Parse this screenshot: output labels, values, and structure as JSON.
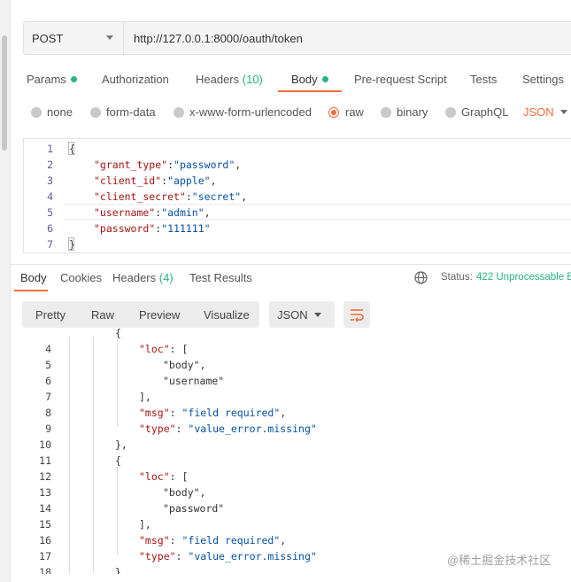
{
  "request": {
    "method": "POST",
    "url": "http://127.0.0.1:8000/oauth/token"
  },
  "request_tabs": {
    "params": "Params",
    "authorization": "Authorization",
    "headers": "Headers",
    "headers_count": "(10)",
    "body": "Body",
    "pre_request": "Pre-request Script",
    "tests": "Tests",
    "settings": "Settings"
  },
  "body_types": {
    "none": "none",
    "form_data": "form-data",
    "urlencoded": "x-www-form-urlencoded",
    "raw": "raw",
    "binary": "binary",
    "graphql": "GraphQL",
    "selected_format": "JSON"
  },
  "request_body": {
    "line_numbers": [
      "1",
      "2",
      "3",
      "4",
      "5",
      "6",
      "7"
    ],
    "open": "{",
    "close": "}",
    "fields": [
      {
        "key": "\"grant_type\"",
        "value": "\"password\"",
        "sep": ","
      },
      {
        "key": "\"client_id\"",
        "value": "\"apple\"",
        "sep": ","
      },
      {
        "key": "\"client_secret\"",
        "value": "\"secret\"",
        "sep": ","
      },
      {
        "key": "\"username\"",
        "value": "\"admin\"",
        "sep": ","
      },
      {
        "key": "\"password\"",
        "value": "\"111111\"",
        "sep": ""
      }
    ]
  },
  "response_tabs": {
    "body": "Body",
    "cookies": "Cookies",
    "headers": "Headers",
    "headers_count": "(4)",
    "test_results": "Test Results"
  },
  "status": {
    "label": "Status:",
    "value": "422 Unprocessable E"
  },
  "response_toolbar": {
    "pretty": "Pretty",
    "raw": "Raw",
    "preview": "Preview",
    "visualize": "Visualize",
    "format": "JSON"
  },
  "response_body": {
    "line_numbers": [
      "4",
      "5",
      "6",
      "7",
      "8",
      "9",
      "10",
      "11",
      "12",
      "13",
      "14",
      "15",
      "16",
      "17",
      "18"
    ],
    "lines": [
      "\"loc\": [",
      "\"body\",",
      "\"username\"",
      "],",
      "\"msg\": \"field required\",",
      "\"type\": \"value_error.missing\"",
      "},",
      "{",
      "\"loc\": [",
      "\"body\",",
      "\"password\"",
      "],",
      "\"msg\": \"field required\",",
      "\"type\": \"value_error.missing\"",
      "}"
    ]
  },
  "watermark": "@稀土掘金技术社区"
}
